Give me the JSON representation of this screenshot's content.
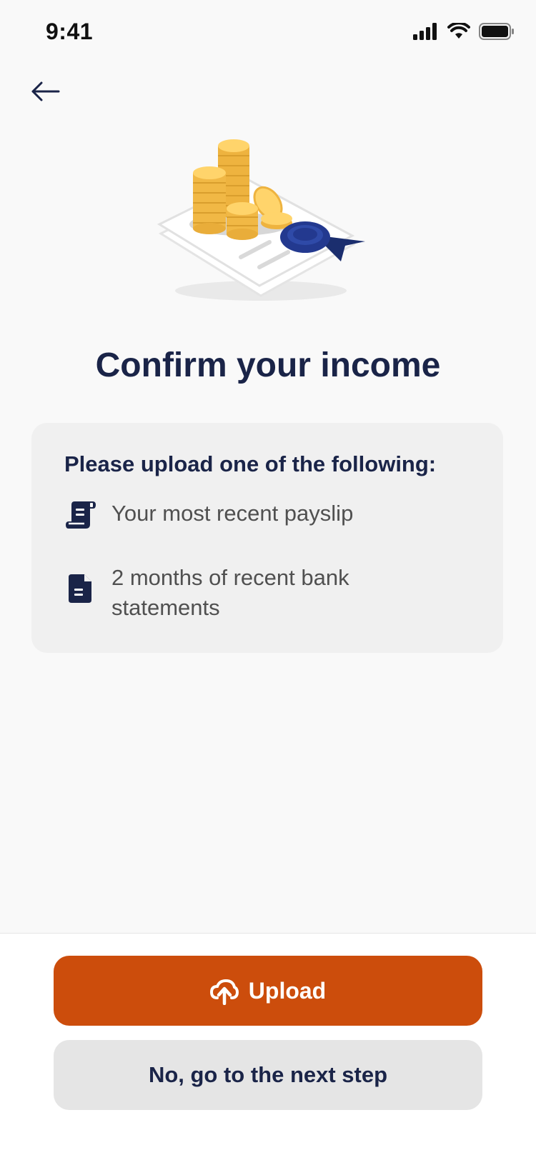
{
  "status_bar": {
    "time": "9:41",
    "icons": [
      "cellular-signal-icon",
      "wifi-icon",
      "battery-icon"
    ]
  },
  "navigation": {
    "back_icon": "arrow-left-icon"
  },
  "illustration": {
    "name": "coins-and-certificate-illustration"
  },
  "main": {
    "title": "Confirm your income",
    "card": {
      "heading": "Please upload one of the following:",
      "items": [
        {
          "icon": "payslip-scroll-icon",
          "label": "Your most recent payslip"
        },
        {
          "icon": "document-icon",
          "label": "2 months of recent bank statements"
        }
      ]
    }
  },
  "actions": {
    "upload_label": "Upload",
    "upload_icon": "cloud-upload-icon",
    "next_step_label": "No, go to the next step"
  },
  "colors": {
    "background": "#f9f9f9",
    "primary_text": "#1a2448",
    "secondary_text": "#505050",
    "card_background": "#f0f0f0",
    "accent": "#cc4d0c",
    "secondary_button": "#e5e5e5",
    "coin_gold": "#f5c659",
    "ribbon_navy": "#23398f"
  }
}
